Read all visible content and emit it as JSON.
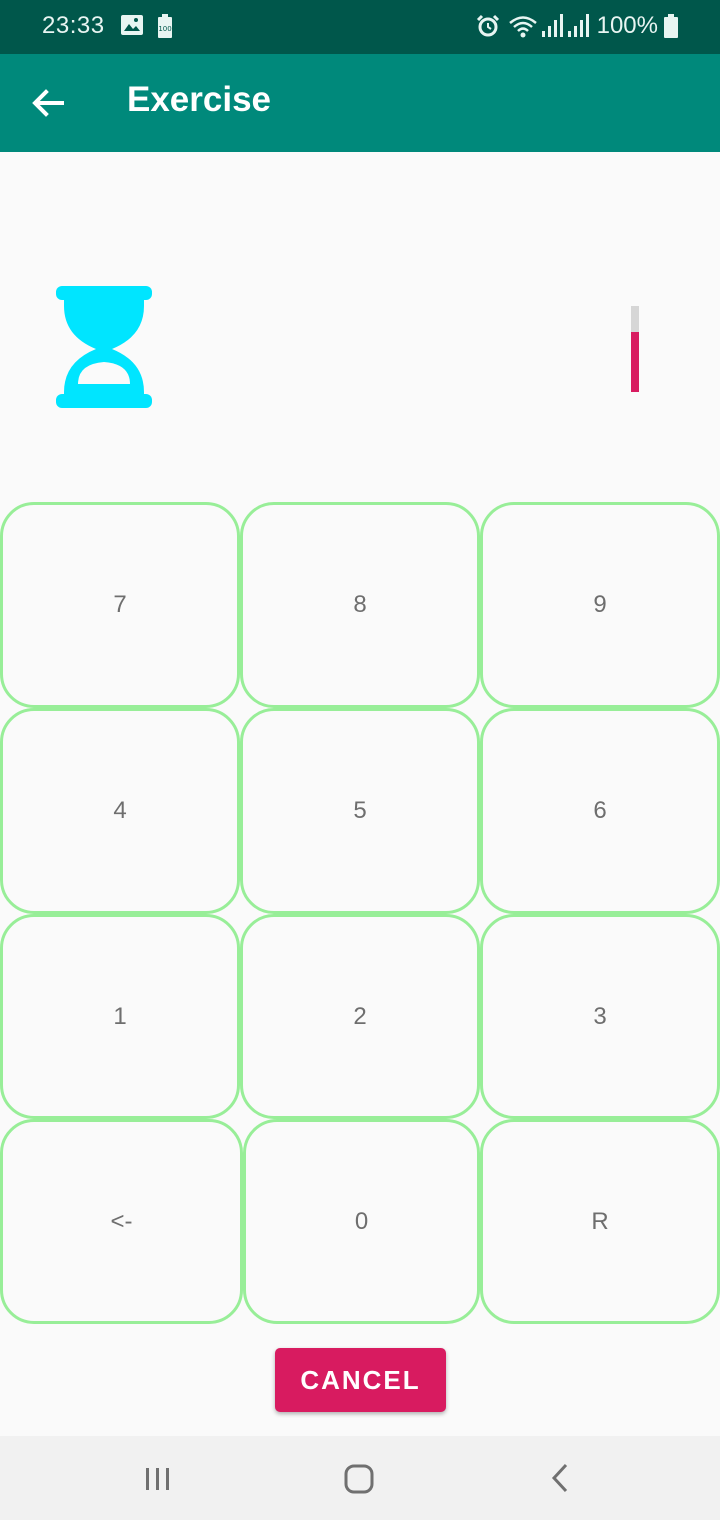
{
  "status_bar": {
    "time": "23:33",
    "battery_percent": "100%",
    "icons": [
      "gallery-icon",
      "battery-saver-icon",
      "alarm-icon",
      "wifi-icon",
      "signal-icon",
      "signal-icon",
      "battery-icon"
    ]
  },
  "app_bar": {
    "title": "Exercise",
    "back_icon": "arrow-left-icon",
    "color": "#00897b",
    "status_color": "#00574b"
  },
  "timer": {
    "icon": "hourglass-icon",
    "icon_color": "#00e5ff",
    "progress_fraction": 0.7,
    "progress_color": "#d81b60"
  },
  "keypad": {
    "border_color": "#98ee98",
    "rows": [
      [
        "7",
        "8",
        "9"
      ],
      [
        "4",
        "5",
        "6"
      ],
      [
        "1",
        "2",
        "3"
      ],
      [
        "<-",
        "0",
        "R"
      ]
    ]
  },
  "actions": {
    "cancel_label": "CANCEL",
    "accent": "#d81b60"
  },
  "nav_bar": {
    "buttons": [
      "recent-apps-icon",
      "home-icon",
      "back-icon"
    ]
  }
}
